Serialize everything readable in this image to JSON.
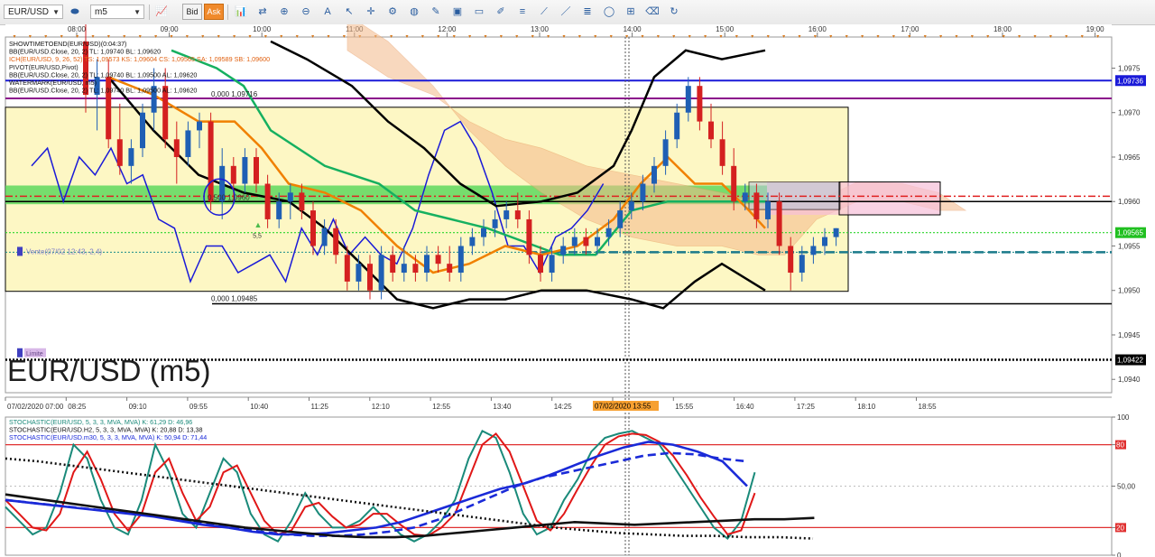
{
  "toolbar": {
    "symbol": "EUR/USD",
    "timeframe": "m5",
    "bid_label": "Bid",
    "ask_label": "Ask",
    "tools": [
      "line-chart-icon",
      "toggle-icon",
      "zoom-in-icon",
      "zoom-out-icon",
      "text-icon",
      "cursor-icon",
      "crosshair-icon",
      "settings-icon",
      "globe-icon",
      "pencil-icon",
      "image-icon",
      "window-icon",
      "draw-icon",
      "list-icon",
      "trend-line-icon",
      "line-icon",
      "fibonacci-icon",
      "ellipse-icon",
      "grid-icon",
      "eraser-icon",
      "refresh-icon"
    ]
  },
  "colors": {
    "bull": "#1f5fb4",
    "bear": "#d42020",
    "ichimoku": "#f08000",
    "kijun": "#16b060",
    "bollinger": "#000000",
    "pivot": "#8b0a8b",
    "price_line": "#2dd62d",
    "ma": "#1a1ad8"
  },
  "chart_data": [
    {
      "type": "candlestick",
      "title": "EUR/USD (m5)",
      "y_axis": {
        "ticks": [
          "1,0975",
          "1,0970",
          "1,0965",
          "1,0960",
          "1,0955",
          "1,0950",
          "1,0945",
          "1,0940"
        ]
      },
      "x_axis_top": {
        "ticks": [
          "08:00",
          "09:00",
          "10:00",
          "11:00",
          "12:00",
          "13:00",
          "14:00",
          "15:00",
          "16:00",
          "17:00",
          "18:00",
          "19:00"
        ]
      },
      "x_axis_bottom": {
        "ticks": [
          "07/02/2020 07:00",
          "08:25",
          "09:10",
          "09:55",
          "10:40",
          "11:25",
          "12:10",
          "12:55",
          "13:40",
          "14:25",
          "15:10",
          "15:55",
          "16:40",
          "17:25",
          "18:10",
          "18:55"
        ],
        "cursor_label": "07/02/2020 13:55"
      },
      "price_labels": [
        {
          "value": "1,09736",
          "color": "#1a1ad8"
        },
        {
          "value": "1,09565",
          "color": "#20c020"
        },
        {
          "value": "1,09422",
          "color": "#000000"
        }
      ],
      "legend": [
        "SHOWTIMETOEND(EUR/USD)(0:04:37)",
        "BB(EUR/USD.Close, 20, 2)  TL: 1,09740  BL: 1,09620",
        "ICH(EUR/USD, 9, 26, 52)  TS: 1,09573  KS: 1,09604  CS: 1,09565  SA: 1,09589  SB: 1,09600",
        "PIVOT(EUR/USD,Pivot)",
        "BB(EUR/USD.Close, 20, 2)  TL: 1,09740  BL: 1,09500  AL: 1,09620",
        "WATERMARK(EUR/USD, m5)",
        "BB(EUR/USD.Close, 20, 2)  TL: 1,09740  BL: 1,09500  AL: 1,09620"
      ],
      "annotations": [
        "0,500  1,0960",
        "0,000  1,09716",
        "0,000  1,09485",
        "5,5",
        "Vente(07/02 12:43,-2,4)",
        "Limite"
      ],
      "candles": [
        {
          "o": 1.0978,
          "h": 1.098,
          "l": 1.097,
          "c": 1.0972
        },
        {
          "o": 1.0972,
          "h": 1.0976,
          "l": 1.0968,
          "c": 1.0974
        },
        {
          "o": 1.0974,
          "h": 1.0976,
          "l": 1.0966,
          "c": 1.0967
        },
        {
          "o": 1.0967,
          "h": 1.0971,
          "l": 1.0963,
          "c": 1.0964
        },
        {
          "o": 1.0964,
          "h": 1.0967,
          "l": 1.0962,
          "c": 1.0966
        },
        {
          "o": 1.0966,
          "h": 1.0971,
          "l": 1.0965,
          "c": 1.097
        },
        {
          "o": 1.097,
          "h": 1.0975,
          "l": 1.0968,
          "c": 1.0973
        },
        {
          "o": 1.0973,
          "h": 1.0975,
          "l": 1.0966,
          "c": 1.0967
        },
        {
          "o": 1.0967,
          "h": 1.0969,
          "l": 1.0962,
          "c": 1.0965
        },
        {
          "o": 1.0965,
          "h": 1.0969,
          "l": 1.0964,
          "c": 1.0968
        },
        {
          "o": 1.0968,
          "h": 1.097,
          "l": 1.0966,
          "c": 1.0969
        },
        {
          "o": 1.0969,
          "h": 1.097,
          "l": 1.0959,
          "c": 1.096
        },
        {
          "o": 1.096,
          "h": 1.0966,
          "l": 1.0958,
          "c": 1.0964
        },
        {
          "o": 1.0964,
          "h": 1.0965,
          "l": 1.096,
          "c": 1.0962
        },
        {
          "o": 1.0962,
          "h": 1.0966,
          "l": 1.0961,
          "c": 1.0965
        },
        {
          "o": 1.0965,
          "h": 1.0966,
          "l": 1.0961,
          "c": 1.0962
        },
        {
          "o": 1.0962,
          "h": 1.0963,
          "l": 1.0957,
          "c": 1.0958
        },
        {
          "o": 1.0958,
          "h": 1.0961,
          "l": 1.0957,
          "c": 1.096
        },
        {
          "o": 1.096,
          "h": 1.0962,
          "l": 1.0958,
          "c": 1.0961
        },
        {
          "o": 1.0961,
          "h": 1.0962,
          "l": 1.0958,
          "c": 1.0959
        },
        {
          "o": 1.0959,
          "h": 1.096,
          "l": 1.0954,
          "c": 1.0955
        },
        {
          "o": 1.0955,
          "h": 1.0958,
          "l": 1.0954,
          "c": 1.0957
        },
        {
          "o": 1.0957,
          "h": 1.0958,
          "l": 1.0953,
          "c": 1.0954
        },
        {
          "o": 1.0954,
          "h": 1.0955,
          "l": 1.095,
          "c": 1.0951
        },
        {
          "o": 1.0951,
          "h": 1.0954,
          "l": 1.095,
          "c": 1.0953
        },
        {
          "o": 1.0953,
          "h": 1.0954,
          "l": 1.0949,
          "c": 1.095
        },
        {
          "o": 1.095,
          "h": 1.0955,
          "l": 1.0949,
          "c": 1.0954
        },
        {
          "o": 1.0954,
          "h": 1.0955,
          "l": 1.0951,
          "c": 1.0952
        },
        {
          "o": 1.0952,
          "h": 1.0955,
          "l": 1.0951,
          "c": 1.0953
        },
        {
          "o": 1.0953,
          "h": 1.0954,
          "l": 1.0951,
          "c": 1.0952
        },
        {
          "o": 1.0952,
          "h": 1.0955,
          "l": 1.0951,
          "c": 1.0954
        },
        {
          "o": 1.0954,
          "h": 1.0955,
          "l": 1.0952,
          "c": 1.0953
        },
        {
          "o": 1.0953,
          "h": 1.0955,
          "l": 1.0951,
          "c": 1.0952
        },
        {
          "o": 1.0952,
          "h": 1.0956,
          "l": 1.0951,
          "c": 1.0955
        },
        {
          "o": 1.0955,
          "h": 1.0957,
          "l": 1.0954,
          "c": 1.0956
        },
        {
          "o": 1.0956,
          "h": 1.0958,
          "l": 1.0955,
          "c": 1.0957
        },
        {
          "o": 1.0957,
          "h": 1.0959,
          "l": 1.0956,
          "c": 1.0958
        },
        {
          "o": 1.0958,
          "h": 1.096,
          "l": 1.0957,
          "c": 1.0959
        },
        {
          "o": 1.0959,
          "h": 1.0961,
          "l": 1.0957,
          "c": 1.0958
        },
        {
          "o": 1.0958,
          "h": 1.0959,
          "l": 1.0953,
          "c": 1.0954
        },
        {
          "o": 1.0954,
          "h": 1.0955,
          "l": 1.0951,
          "c": 1.0952
        },
        {
          "o": 1.0952,
          "h": 1.0955,
          "l": 1.0951,
          "c": 1.0954
        },
        {
          "o": 1.0954,
          "h": 1.0956,
          "l": 1.0953,
          "c": 1.0955
        },
        {
          "o": 1.0955,
          "h": 1.0957,
          "l": 1.0954,
          "c": 1.0956
        },
        {
          "o": 1.0956,
          "h": 1.0957,
          "l": 1.0954,
          "c": 1.0955
        },
        {
          "o": 1.0955,
          "h": 1.0957,
          "l": 1.0954,
          "c": 1.0956
        },
        {
          "o": 1.0956,
          "h": 1.0958,
          "l": 1.0955,
          "c": 1.0957
        },
        {
          "o": 1.0957,
          "h": 1.096,
          "l": 1.0956,
          "c": 1.0959
        },
        {
          "o": 1.0959,
          "h": 1.0961,
          "l": 1.0958,
          "c": 1.096
        },
        {
          "o": 1.096,
          "h": 1.0963,
          "l": 1.0959,
          "c": 1.0962
        },
        {
          "o": 1.0962,
          "h": 1.0965,
          "l": 1.0961,
          "c": 1.0964
        },
        {
          "o": 1.0964,
          "h": 1.0968,
          "l": 1.0963,
          "c": 1.0967
        },
        {
          "o": 1.0967,
          "h": 1.0971,
          "l": 1.0966,
          "c": 1.097
        },
        {
          "o": 1.097,
          "h": 1.0974,
          "l": 1.0969,
          "c": 1.0973
        },
        {
          "o": 1.0973,
          "h": 1.0974,
          "l": 1.0968,
          "c": 1.0969
        },
        {
          "o": 1.0969,
          "h": 1.0971,
          "l": 1.0966,
          "c": 1.0967
        },
        {
          "o": 1.0967,
          "h": 1.0969,
          "l": 1.0963,
          "c": 1.0964
        },
        {
          "o": 1.0964,
          "h": 1.0966,
          "l": 1.0959,
          "c": 1.096
        },
        {
          "o": 1.096,
          "h": 1.0962,
          "l": 1.0959,
          "c": 1.0961
        },
        {
          "o": 1.0961,
          "h": 1.0962,
          "l": 1.0957,
          "c": 1.0958
        },
        {
          "o": 1.0958,
          "h": 1.0961,
          "l": 1.0957,
          "c": 1.096
        },
        {
          "o": 1.096,
          "h": 1.0961,
          "l": 1.0954,
          "c": 1.0955
        },
        {
          "o": 1.0955,
          "h": 1.0956,
          "l": 1.095,
          "c": 1.0952
        },
        {
          "o": 1.0952,
          "h": 1.0955,
          "l": 1.0951,
          "c": 1.0954
        },
        {
          "o": 1.0954,
          "h": 1.0956,
          "l": 1.0953,
          "c": 1.0955
        },
        {
          "o": 1.0955,
          "h": 1.0957,
          "l": 1.0954,
          "c": 1.0956
        },
        {
          "o": 1.0956,
          "h": 1.0957,
          "l": 1.0955,
          "c": 1.0957
        }
      ]
    },
    {
      "type": "line",
      "title": "Stochastic",
      "y_axis": {
        "ticks": [
          "100",
          "80",
          "50,00",
          "20",
          "0"
        ],
        "range": [
          0,
          100
        ]
      },
      "legend": [
        "STOCHASTIC(EUR/USD, 5, 3, 3, MVA, MVA)  K: 61,29  D: 46,96",
        "STOCHASTIC(EUR/USD.H2, 5, 3, 3, MVA, MVA)  K: 20,88  D: 13,38",
        "STOCHASTIC(EUR/USD.m30, 5, 3, 3, MVA, MVA)  K: 50,94  D: 71,44"
      ],
      "series": [
        {
          "values": [
            35,
            25,
            15,
            20,
            45,
            80,
            70,
            40,
            20,
            15,
            40,
            80,
            60,
            30,
            20,
            45,
            70,
            60,
            30,
            15,
            10,
            25,
            45,
            30,
            20,
            20,
            25,
            35,
            25,
            15,
            10,
            15,
            25,
            40,
            70,
            90,
            85,
            60,
            30,
            15,
            20,
            40,
            55,
            75,
            85,
            88,
            90,
            85,
            80,
            65,
            50,
            35,
            20,
            12,
            25,
            60
          ]
        },
        {
          "values": [
            40,
            30,
            20,
            18,
            30,
            60,
            75,
            55,
            30,
            18,
            30,
            60,
            70,
            45,
            25,
            35,
            60,
            65,
            45,
            25,
            15,
            18,
            35,
            38,
            28,
            20,
            22,
            30,
            30,
            22,
            15,
            14,
            20,
            30,
            55,
            80,
            88,
            75,
            50,
            25,
            18,
            30,
            48,
            65,
            80,
            86,
            88,
            87,
            82,
            72,
            58,
            42,
            28,
            15,
            18,
            45
          ]
        },
        {
          "values": [
            40,
            38,
            36,
            34,
            32,
            30,
            28,
            25,
            22,
            20,
            17,
            15,
            15,
            16,
            18,
            20,
            24,
            30,
            36,
            42,
            48,
            52,
            58,
            65,
            72,
            78,
            82,
            80,
            75,
            68,
            50
          ]
        },
        {
          "values": [
            40,
            38,
            36,
            34,
            32,
            30,
            28,
            25,
            22,
            20,
            17,
            15,
            14,
            14,
            15,
            17,
            20,
            26,
            34,
            42,
            50,
            56,
            60,
            64,
            68,
            72,
            74,
            73,
            70,
            68
          ]
        },
        {
          "values": [
            44,
            41,
            38,
            35,
            32,
            29,
            26,
            23,
            20,
            18,
            16,
            14,
            13,
            13,
            14,
            16,
            18,
            20,
            22,
            24,
            23,
            22,
            23,
            24,
            25,
            26,
            26,
            27
          ]
        },
        {
          "values": [
            70,
            68,
            65,
            62,
            59,
            56,
            53,
            50,
            47,
            44,
            41,
            38,
            35,
            32,
            29,
            26,
            23,
            20,
            18,
            16,
            15,
            14,
            14,
            13,
            13,
            12
          ]
        }
      ]
    }
  ]
}
